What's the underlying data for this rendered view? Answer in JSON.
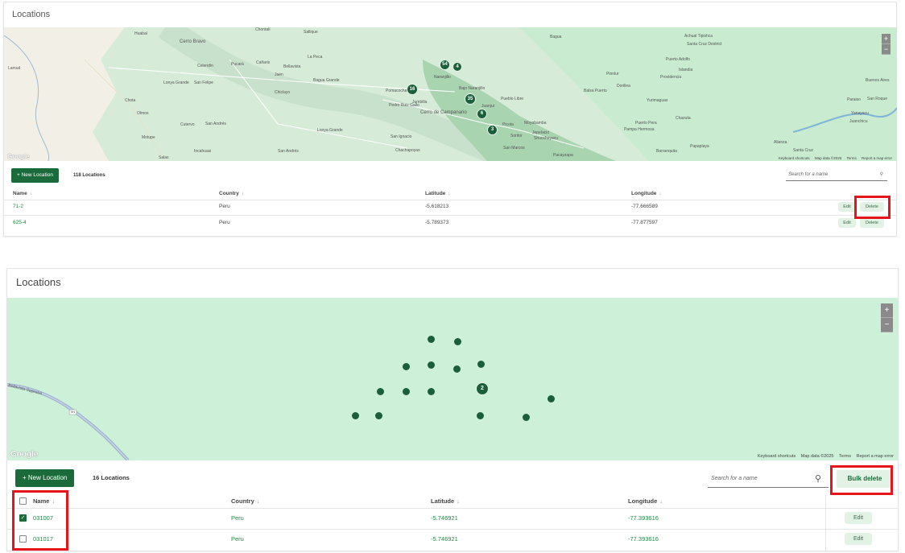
{
  "panel1": {
    "title": "Locations",
    "map": {
      "zoom_in": "+",
      "zoom_out": "−",
      "logo": "Google",
      "footer": [
        "Keyboard shortcuts",
        "Map data ©2025",
        "Terms",
        "Report a map error"
      ],
      "clusters": [
        "54",
        "4",
        "16",
        "35",
        "6",
        "3"
      ],
      "places": [
        "Cerro Bravo",
        "Cerro de Campanario",
        "Chiclayo",
        "Jaén",
        "Bagua Grande",
        "La Peca",
        "San Felipe",
        "Moyobamba",
        "Nueva Cajamarca",
        "Rioja",
        "Juanjui",
        "Picota",
        "Bellavista",
        "Yurimaguas",
        "Saposoa",
        "Lamas",
        "Tarapoto",
        "Huallaga",
        "Chachapoyas",
        "Pomacocha",
        "Pedro Ruiz Gallo",
        "Jumbilla",
        "Naranjillo",
        "Bagua",
        "San Ignacio",
        "Huancabamba",
        "Olmos",
        "Motupe",
        "Salas",
        "Incahuasi",
        "San Andrés",
        "Cutervo",
        "Chota",
        "Lonya Grande",
        "Lamud",
        "Celendín",
        "Pucará",
        "Cañaris",
        "Corral de Arena",
        "Sallique",
        "Chontalí",
        "Huabal",
        "Aramango",
        "La Coipa",
        "Chirinos",
        "Colasay",
        "Pomahuaca",
        "Yamón",
        "Cajaruro",
        "Bongará",
        "Soritor",
        "Jepelacio",
        "Shucshuyacu",
        "San Marcos",
        "Pacayzapa",
        "Pampa Hermosa",
        "Barranquita",
        "Papaplaya",
        "Alianza",
        "Santa Cruz",
        "Balsa Puerto",
        "Providencia",
        "Puerto Adolfo",
        "Jeberos",
        "Shucushuyacu",
        "Achual Tipishca",
        "Santa Cruz Destrict",
        "Islandia",
        "Buenos Aires",
        "Paraiso",
        "San Roque",
        "Yanayacu",
        "Juanchicu",
        "Chazuta",
        "Sauce",
        "Lagunas",
        "Pinnlur",
        "Dorillea",
        "Puerto Pera",
        "Pueblo Libre",
        "Yuvilan",
        "Bajo Naranjillo"
      ]
    },
    "toolbar": {
      "new_location": "+ New Location",
      "count": "118 Locations",
      "search_placeholder": "Search for a name",
      "search_icon": "search-icon"
    },
    "columns": [
      "Name",
      "Country",
      "Latitude",
      "Longitude"
    ],
    "rows": [
      {
        "name": "71-2",
        "country": "Peru",
        "lat": "-5.618213",
        "lon": "-77.666589",
        "edit": "Edit",
        "delete": "Delete"
      },
      {
        "name": "625-4",
        "country": "Peru",
        "lat": "-5.789373",
        "lon": "-77.877597",
        "edit": "Edit",
        "delete": "Delete"
      }
    ]
  },
  "panel2": {
    "title": "Locations",
    "map": {
      "zoom_in": "+",
      "zoom_out": "−",
      "logo": "Google",
      "footer": [
        "Keyboard shortcuts",
        "Map data ©2025",
        "Terms",
        "Report a map error"
      ],
      "road_label": "Bellavista-Saposoa",
      "road_shield": "5N",
      "cluster_label": "2"
    },
    "toolbar": {
      "new_location": "+ New Location",
      "count": "16 Locations",
      "search_placeholder": "Search for a name",
      "bulk_delete": "Bulk delete"
    },
    "columns": [
      "Name",
      "Country",
      "Latitude",
      "Longitude"
    ],
    "rows": [
      {
        "name": "031007",
        "country": "Peru",
        "lat": "-5.746921",
        "lon": "-77.393616",
        "edit": "Edit",
        "checked": true
      },
      {
        "name": "031017",
        "country": "Peru",
        "lat": "-5.746921",
        "lon": "-77.393616",
        "edit": "Edit",
        "checked": false
      }
    ]
  },
  "colors": {
    "accent": "#1b6b3a",
    "link": "#1f8a43",
    "highlight": "#e8141c",
    "map_bg": "#cfe9d6"
  }
}
